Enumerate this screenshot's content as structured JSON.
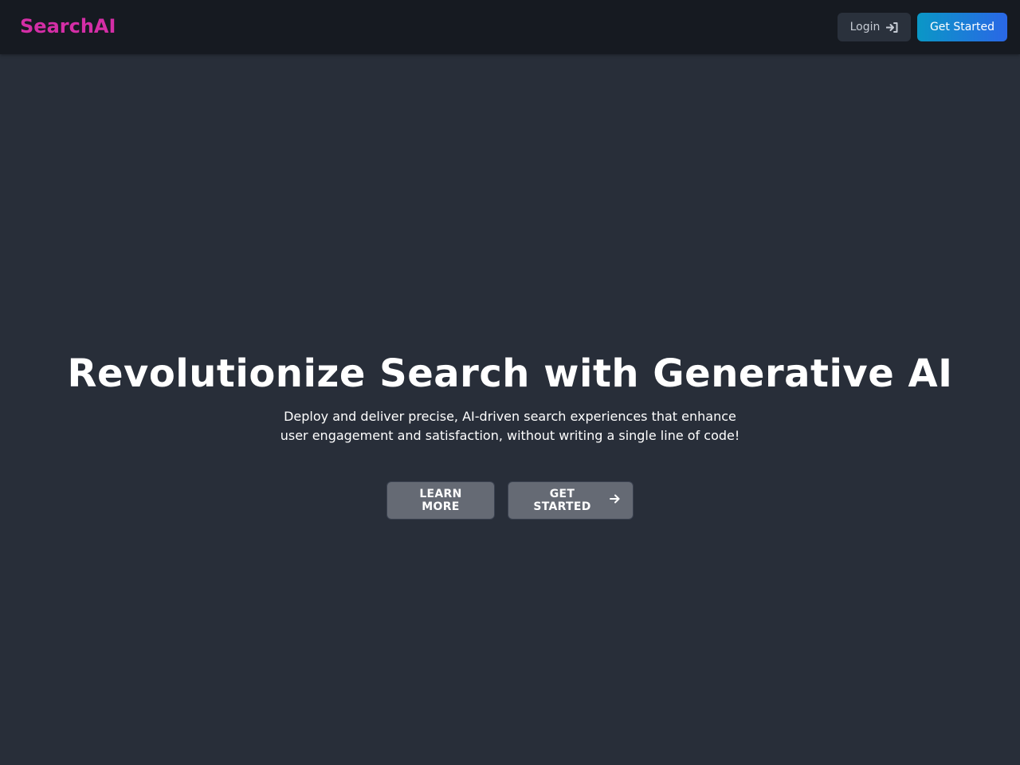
{
  "brand": {
    "name": "SearchAI",
    "color": "#d42ea6"
  },
  "nav": {
    "login_label": "Login",
    "login_icon": "sign-in-icon",
    "get_started_label": "Get Started"
  },
  "hero": {
    "title": "Revolutionize Search with Generative AI",
    "subtitle": "Deploy and deliver precise, AI-driven search experiences that enhance user engagement and satisfaction, without writing a single line of code!",
    "learn_more_label": "LEARN MORE",
    "get_started_label": "GET STARTED",
    "get_started_icon": "arrow-right-icon"
  },
  "colors": {
    "background": "#282e39",
    "navbar": "#161a21",
    "accent_gradient_start": "#0a97c6",
    "accent_gradient_end": "#2a67e6"
  }
}
